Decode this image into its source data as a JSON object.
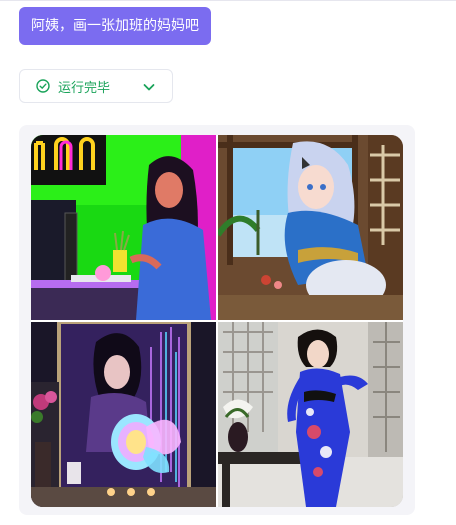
{
  "prompt": {
    "text": "阿姨，画一张加班的妈妈吧"
  },
  "status": {
    "label": "运行完毕",
    "state_icon": "check-circle-icon",
    "toggle_icon": "chevron-down-icon",
    "color": "#1aa35a"
  },
  "colors": {
    "bubble": "#7b6cf0",
    "panel": "#f4f4f8"
  },
  "gallery": {
    "images": [
      {
        "subject": "neon office woman at computer"
      },
      {
        "subject": "anime girl in blue kimono by window"
      },
      {
        "subject": "woman with glowing butterfly in mirror"
      },
      {
        "subject": "woman in blue qipao in room"
      }
    ]
  }
}
